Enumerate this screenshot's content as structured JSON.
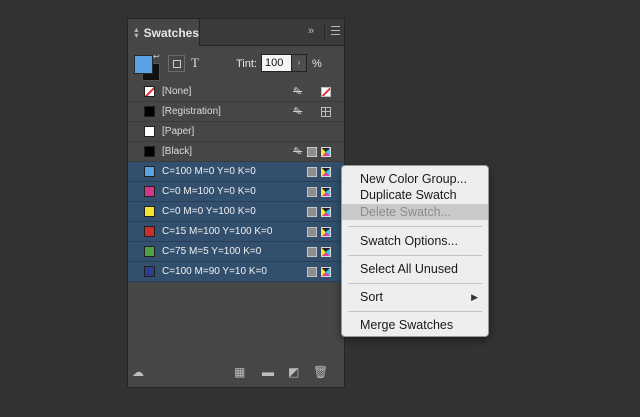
{
  "panel": {
    "title": "Swatches",
    "collapse_glyph": "»",
    "tint_label": "Tint:",
    "tint_value": "100",
    "tint_unit": "%",
    "text_icon": "T"
  },
  "colors": {
    "fill_swatch": "#5aa2e3",
    "selection": "#334f6e"
  },
  "swatches": [
    {
      "name": "[None]",
      "color": "none",
      "selected": false,
      "icons": [
        "no-edit-icon",
        "none-icon"
      ]
    },
    {
      "name": "[Registration]",
      "color": "#000000",
      "selected": false,
      "icons": [
        "no-edit-icon",
        "registration-icon"
      ]
    },
    {
      "name": "[Paper]",
      "color": "#ffffff",
      "selected": false,
      "icons": []
    },
    {
      "name": "[Black]",
      "color": "#000000",
      "selected": false,
      "icons": [
        "no-edit-icon",
        "process-color-icon",
        "cmyk-icon"
      ]
    },
    {
      "name": "C=100 M=0 Y=0 K=0",
      "color": "#5aa2e3",
      "selected": true,
      "icons": [
        "process-color-icon",
        "cmyk-icon"
      ]
    },
    {
      "name": "C=0 M=100 Y=0 K=0",
      "color": "#d0388a",
      "selected": true,
      "icons": [
        "process-color-icon",
        "cmyk-icon"
      ]
    },
    {
      "name": "C=0 M=0 Y=100 K=0",
      "color": "#f2e633",
      "selected": true,
      "icons": [
        "process-color-icon",
        "cmyk-icon"
      ]
    },
    {
      "name": "C=15 M=100 Y=100 K=0",
      "color": "#c62f2a",
      "selected": true,
      "icons": [
        "process-color-icon",
        "cmyk-icon"
      ]
    },
    {
      "name": "C=75 M=5 Y=100 K=0",
      "color": "#4da047",
      "selected": true,
      "icons": [
        "process-color-icon",
        "cmyk-icon"
      ]
    },
    {
      "name": "C=100 M=90 Y=10 K=0",
      "color": "#2c3f8c",
      "selected": true,
      "icons": [
        "process-color-icon",
        "cmyk-icon"
      ]
    }
  ],
  "context_menu": {
    "items": [
      {
        "label": "New Color Group..."
      },
      {
        "label": "Duplicate Swatch"
      },
      {
        "label": "Delete Swatch...",
        "highlighted": true
      },
      {
        "label": "Swatch Options..."
      },
      {
        "label": "Select All Unused"
      },
      {
        "label": "Sort",
        "submenu": true
      },
      {
        "label": "Merge Swatches"
      }
    ],
    "submenu_arrow": "▶"
  }
}
